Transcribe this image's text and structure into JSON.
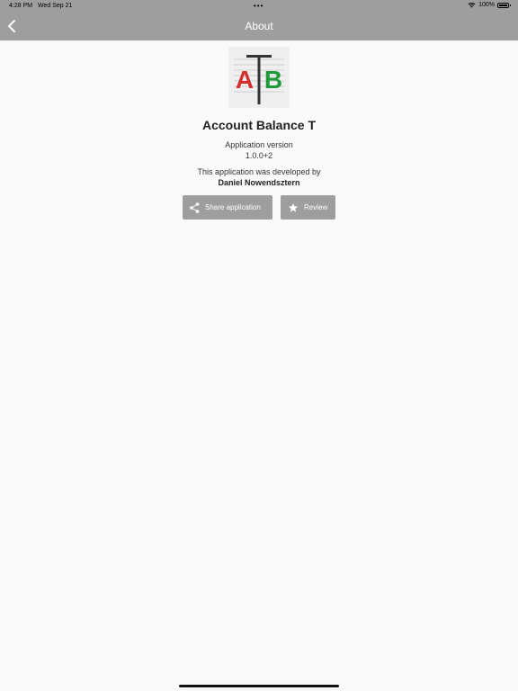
{
  "status_bar": {
    "time": "4:28 PM",
    "date": "Wed Sep 21",
    "dots": "•••",
    "battery": "100%"
  },
  "header": {
    "title": "About"
  },
  "about": {
    "logo_letters": [
      "A",
      "T",
      "B"
    ],
    "app_name": "Account Balance T",
    "version_label": "Application version",
    "version_value": "1.0.0+2",
    "developed_label": "This application was developed by",
    "developer_name": "Daniel Nowendsztern"
  },
  "actions": {
    "share_label": "Share application",
    "review_label": "Review"
  },
  "colors": {
    "appbar": "#9e9e9e",
    "background": "#fafafa",
    "logo_red": "#d32f2f",
    "logo_green": "#1e9a3a"
  },
  "icons": {
    "back": "chevron-left-icon",
    "share": "share-icon",
    "review": "star-icon",
    "wifi": "wifi-icon",
    "battery": "battery-icon"
  }
}
